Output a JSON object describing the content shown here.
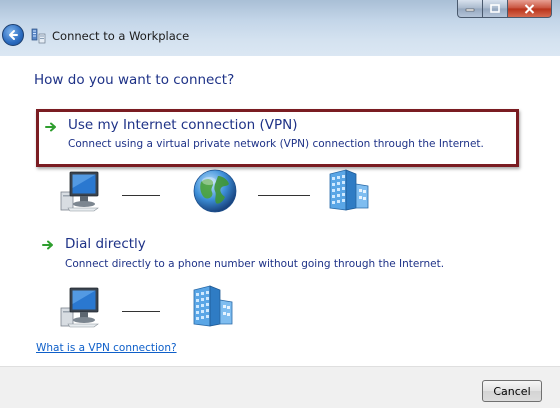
{
  "window": {
    "title": "Connect to a Workplace",
    "caption_buttons": [
      "minimize-icon",
      "maximize-icon",
      "close-icon"
    ]
  },
  "content": {
    "heading": "How do you want to connect?",
    "options": [
      {
        "title": "Use my Internet connection (VPN)",
        "description": "Connect using a virtual private network (VPN) connection through the Internet.",
        "highlighted": true,
        "diagram": [
          "computer-icon",
          "globe-icon",
          "building-icon"
        ]
      },
      {
        "title": "Dial directly",
        "description": "Connect directly to a phone number without going through the Internet.",
        "highlighted": false,
        "diagram": [
          "computer-icon",
          "building-icon"
        ]
      }
    ],
    "help_link": "What is a VPN connection?"
  },
  "footer": {
    "cancel_label": "Cancel"
  },
  "colors": {
    "link_blue": "#1e3287",
    "highlight_border": "#7a1c22",
    "arrow_green": "#2e9e2e"
  }
}
